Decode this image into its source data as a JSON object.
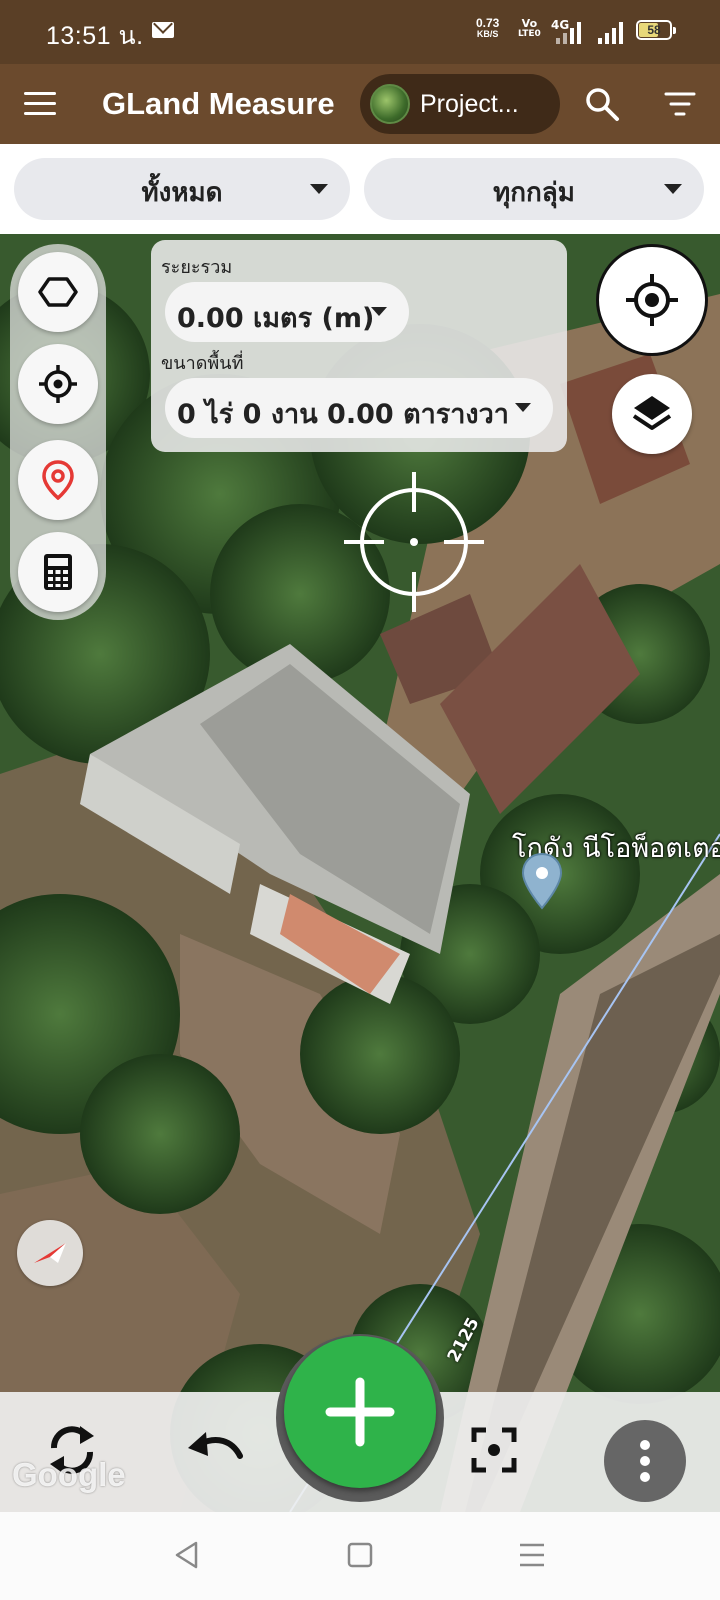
{
  "status_bar": {
    "time": "13:51 น.",
    "speed_value": "0.73",
    "speed_unit": "KB/S",
    "volte_top": "Vo",
    "volte_bottom": "LTE0",
    "network": "4G",
    "battery": "58"
  },
  "app_bar": {
    "title": "GLand Measure",
    "project_label": "Project..."
  },
  "filters": {
    "left_dropdown": "ทั้งหมด",
    "right_dropdown": "ทุกกลุ่ม"
  },
  "measure_panel": {
    "distance_label": "ระยะรวม",
    "distance_value": "0.00 เมตร (m)",
    "area_label": "ขนาดพื้นที่",
    "area_value": "0 ไร่ 0 งาน 0.00 ตารางวา"
  },
  "map": {
    "place_name": "โกดัง นีโอพ็อตเตอ",
    "road_number": "2125",
    "attribution": "Google"
  },
  "icons": {
    "menu": "hamburger-icon",
    "search": "search-icon",
    "filter": "filter-icon",
    "polygon": "polygon-icon",
    "crosshair": "crosshair-icon",
    "marker": "map-pin-icon",
    "calculator": "calculator-icon",
    "gps": "gps-locate-icon",
    "layers": "layers-icon",
    "compass": "compass-icon",
    "refresh": "refresh-icon",
    "undo": "undo-icon",
    "add": "plus-icon",
    "fit": "focus-frame-icon",
    "more": "more-vertical-icon"
  },
  "colors": {
    "app_bar": "#6b4a2d",
    "status_bar": "#5a3f26",
    "fab": "#2fb34a",
    "marker": "#e53935"
  }
}
